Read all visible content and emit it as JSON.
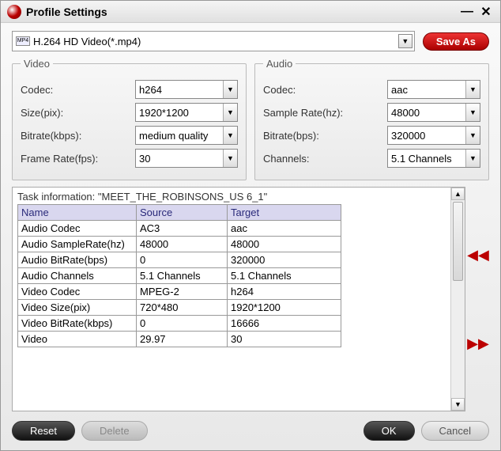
{
  "window": {
    "title": "Profile Settings",
    "minimize_glyph": "—",
    "close_glyph": "✕"
  },
  "profile": {
    "format_icon_label": "MP4",
    "selected": "H.264 HD Video(*.mp4)",
    "save_as_label": "Save As"
  },
  "video": {
    "legend": "Video",
    "codec_label": "Codec:",
    "codec_value": "h264",
    "size_label": "Size(pix):",
    "size_value": "1920*1200",
    "bitrate_label": "Bitrate(kbps):",
    "bitrate_value": "medium quality",
    "framerate_label": "Frame Rate(fps):",
    "framerate_value": "30"
  },
  "audio": {
    "legend": "Audio",
    "codec_label": "Codec:",
    "codec_value": "aac",
    "samplerate_label": "Sample Rate(hz):",
    "samplerate_value": "48000",
    "bitrate_label": "Bitrate(bps):",
    "bitrate_value": "320000",
    "channels_label": "Channels:",
    "channels_value": "5.1 Channels"
  },
  "task": {
    "header_prefix": "Task information: ",
    "header_name": "\"MEET_THE_ROBINSONS_US 6_1\"",
    "columns": {
      "name": "Name",
      "source": "Source",
      "target": "Target"
    },
    "rows": [
      {
        "name": "Audio Codec",
        "source": "AC3",
        "target": "aac"
      },
      {
        "name": "Audio SampleRate(hz)",
        "source": "48000",
        "target": "48000"
      },
      {
        "name": "Audio BitRate(bps)",
        "source": "0",
        "target": "320000"
      },
      {
        "name": "Audio Channels",
        "source": "5.1 Channels",
        "target": "5.1 Channels"
      },
      {
        "name": "Video Codec",
        "source": "MPEG-2",
        "target": "h264"
      },
      {
        "name": "Video Size(pix)",
        "source": "720*480",
        "target": "1920*1200"
      },
      {
        "name": "Video BitRate(kbps)",
        "source": "0",
        "target": "16666"
      },
      {
        "name": "Video",
        "source": "29.97",
        "target": "30"
      }
    ]
  },
  "nav": {
    "prev_glyph": "◀◀",
    "next_glyph": "▶▶"
  },
  "footer": {
    "reset": "Reset",
    "delete": "Delete",
    "ok": "OK",
    "cancel": "Cancel"
  },
  "caret_glyph": "▼",
  "scroll_up_glyph": "▲",
  "scroll_down_glyph": "▼"
}
